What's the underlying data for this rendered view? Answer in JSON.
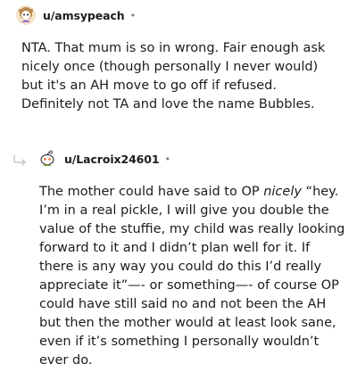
{
  "comments": [
    {
      "username": "u/amsypeach",
      "separator": "•",
      "avatar_icon": "snoo-avatar-girl-icon",
      "body": "NTA. That mum is so in wrong. Fair enough ask nicely once (though personally I never would) but it's an AH move to go off if refused. Definitely not TA and love the name Bubbles."
    },
    {
      "username": "u/Lacroix24601",
      "separator": "•",
      "avatar_icon": "snoo-avatar-icon",
      "reply_icon": "reply-arrow-icon",
      "body_before_italic": "The mother could have said to OP ",
      "body_italic": "nicely",
      "body_after_italic": " “hey. I’m in a real pickle, I will give you double the value of the stuffie, my child was really looking forward to it and I didn’t plan well for it. If there is any way you could do this I’d really appreciate it”—- or something—- of course OP could have still said no and not been the AH but then the mother would at least look sane, even if it’s something I personally wouldn’t ever do."
    }
  ]
}
